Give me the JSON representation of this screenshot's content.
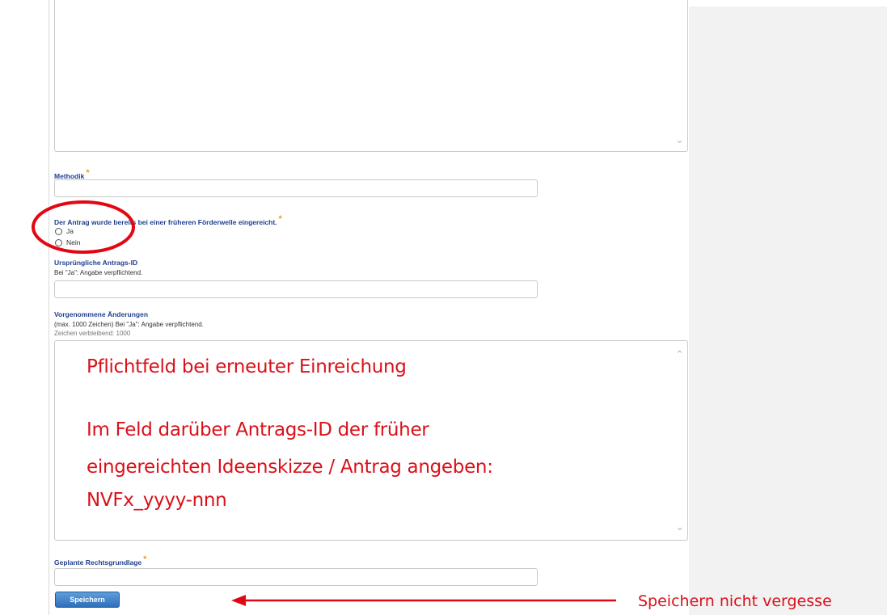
{
  "fields": {
    "description": {
      "value": ""
    },
    "methodik": {
      "label": "Methodik",
      "required_mark": "*",
      "value": ""
    },
    "previous_wave": {
      "label": "Der Antrag wurde bereits bei einer früheren Förderwelle eingereicht.",
      "required_mark": "*",
      "options": [
        {
          "label": "Ja",
          "checked": false
        },
        {
          "label": "Nein",
          "checked": false
        }
      ]
    },
    "original_id": {
      "label": "Ursprüngliche Antrags-ID",
      "help": "Bei \"Ja\": Angabe verpflichtend.",
      "value": ""
    },
    "changes": {
      "label": "Vorgenommene Änderungen",
      "help": "(max. 1000 Zeichen) Bei \"Ja\": Angabe verpflichtend.",
      "counter": "Zeichen verbleibend: 1000"
    },
    "legal_basis": {
      "label": "Geplante Rechtsgrundlage",
      "required_mark": "*",
      "value": ""
    }
  },
  "save_button": "Speichern",
  "overlay": {
    "line1": "Pflichtfeld bei erneuter Einreichung",
    "line2": "Im Feld darüber Antrags-ID der früher",
    "line3": "eingereichten Ideenskizze / Antrag angeben:",
    "line4": "NVFx_yyyy-nnn",
    "annotation": "Speichern nicht vergesse",
    "color": "#d9111a"
  },
  "colors": {
    "label": "#1f3f8f",
    "required": "#f39a1e",
    "button": "#3a7bc8"
  }
}
